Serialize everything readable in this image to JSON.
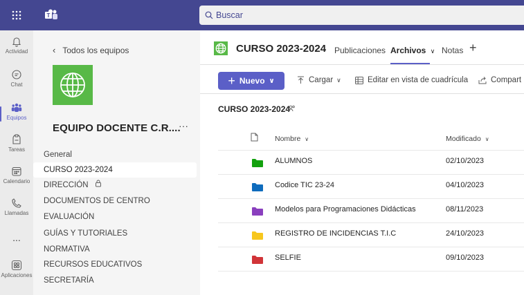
{
  "search": {
    "placeholder": "Buscar"
  },
  "rail": {
    "items": [
      {
        "label": "Actividad",
        "icon": "bell-icon"
      },
      {
        "label": "Chat",
        "icon": "chat-icon"
      },
      {
        "label": "Equipos",
        "icon": "teams-icon",
        "active": true
      },
      {
        "label": "Tareas",
        "icon": "assignments-icon"
      },
      {
        "label": "Calendario",
        "icon": "calendar-icon"
      },
      {
        "label": "Llamadas",
        "icon": "phone-icon"
      },
      {
        "label": "...",
        "icon": "more-icon"
      },
      {
        "label": "Aplicaciones",
        "icon": "apps-icon"
      }
    ]
  },
  "panel": {
    "back_label": "Todos los equipos",
    "team_name": "EQUIPO DOCENTE C.R....",
    "more": "···",
    "channels": [
      {
        "label": "General"
      },
      {
        "label": "CURSO 2023-2024",
        "selected": true
      },
      {
        "label": "DIRECCIÓN",
        "locked": true
      },
      {
        "label": "DOCUMENTOS DE CENTRO"
      },
      {
        "label": "EVALUACIÓN"
      },
      {
        "label": "GUÍAS Y TUTORIALES"
      },
      {
        "label": "NORMATIVA"
      },
      {
        "label": "RECURSOS EDUCATIVOS"
      },
      {
        "label": "SECRETARÍA"
      }
    ]
  },
  "channel": {
    "title": "CURSO 2023-2024",
    "tabs": {
      "publicaciones": "Publicaciones",
      "archivos": "Archivos",
      "notas": "Notas"
    },
    "plus": "+"
  },
  "toolbar": {
    "new_label": "Nuevo",
    "upload_label": "Cargar",
    "grid_label": "Editar en vista de cuadrícula",
    "share_label": "Compart"
  },
  "files": {
    "breadcrumb": "CURSO 2023-2024",
    "columns": {
      "name": "Nombre",
      "modified": "Modificado"
    },
    "rows": [
      {
        "name": "ALUMNOS",
        "modified": "02/10/2023",
        "color": "#13a10e"
      },
      {
        "name": "Codice TIC 23-24",
        "modified": "04/10/2023",
        "color": "#0f6cbd"
      },
      {
        "name": "Modelos para Programaciones Didácticas",
        "modified": "08/11/2023",
        "color": "#8a3fbe"
      },
      {
        "name": "REGISTRO DE INCIDENCIAS T.I.C",
        "modified": "24/10/2023",
        "color": "#f7c71e"
      },
      {
        "name": "SELFIE",
        "modified": "09/10/2023",
        "color": "#d13438"
      }
    ]
  },
  "colors": {
    "brand": "#444791",
    "accent": "#5b5fc7",
    "team_logo": "#58b947"
  }
}
